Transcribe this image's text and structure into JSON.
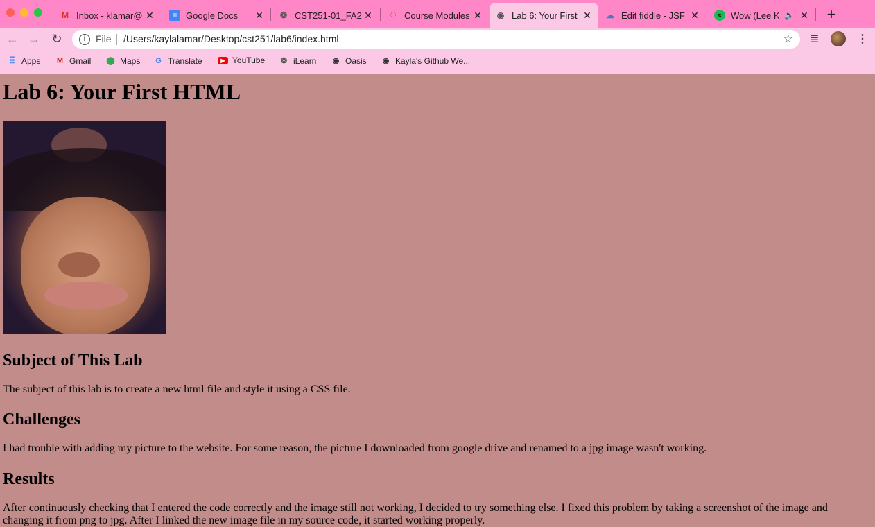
{
  "tabs": [
    {
      "title": "Inbox - klamar@",
      "icon": "gmail-icon",
      "active": false
    },
    {
      "title": "Google Docs",
      "icon": "google-docs-icon",
      "active": false
    },
    {
      "title": "CST251-01_FA2",
      "icon": "ilearn-icon",
      "active": false
    },
    {
      "title": "Course Modules",
      "icon": "canvas-icon",
      "active": false
    },
    {
      "title": "Lab 6: Your First",
      "icon": "globe-icon",
      "active": true
    },
    {
      "title": "Edit fiddle - JSF",
      "icon": "jsfiddle-icon",
      "active": false
    },
    {
      "title": "Wow (Lee K",
      "icon": "spotify-icon",
      "active": false
    }
  ],
  "omnibox": {
    "scheme_label": "File",
    "url": "/Users/kaylalamar/Desktop/cst251/lab6/index.html"
  },
  "bookmarks": [
    {
      "label": "Apps",
      "icon": "apps-grid-icon"
    },
    {
      "label": "Gmail",
      "icon": "gmail-icon"
    },
    {
      "label": "Maps",
      "icon": "maps-icon"
    },
    {
      "label": "Translate",
      "icon": "translate-icon"
    },
    {
      "label": "YouTube",
      "icon": "youtube-icon"
    },
    {
      "label": "iLearn",
      "icon": "ilearn-icon"
    },
    {
      "label": "Oasis",
      "icon": "globe-icon"
    },
    {
      "label": "Kayla's Github We...",
      "icon": "globe-icon"
    }
  ],
  "page": {
    "heading": "Lab 6: Your First HTML",
    "sections": [
      {
        "title": "Subject of This Lab",
        "body": "The subject of this lab is to create a new html file and style it using a CSS file."
      },
      {
        "title": "Challenges",
        "body": "I had trouble with adding my picture to the website. For some reason, the picture I downloaded from google drive and renamed to a jpg image wasn't working."
      },
      {
        "title": "Results",
        "body": "After continuously checking that I entered the code correctly and the image still not working, I decided to try something else. I fixed this problem by taking a screenshot of the image and changing it from png to jpg. After I linked the new image file in my source code, it started working properly."
      }
    ]
  },
  "colors": {
    "chrome": "#ff86c7",
    "toolbar": "#fbc8e6",
    "page_bg": "#c28c8b"
  }
}
